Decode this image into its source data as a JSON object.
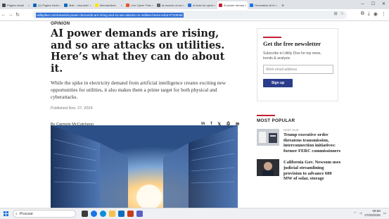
{
  "browser": {
    "tabs": [
      {
        "label": "Página Inicial",
        "color": "#4a4a4a",
        "active": false
      },
      {
        "label": "(2) Página Inicial",
        "color": "#0a66c2",
        "active": false
      },
      {
        "label": "Mail – elsa.abei",
        "color": "#0f6cbd",
        "active": false
      },
      {
        "label": "Mercadolivre",
        "color": "#ffe600",
        "active": false
      },
      {
        "label": "Live Cyber Threat",
        "color": "#e4572e",
        "active": false
      },
      {
        "label": "ai-recover-of-ener",
        "color": "#5f6368",
        "active": false
      },
      {
        "label": "AI bots for cyberc",
        "color": "#2a6fdb",
        "active": false
      },
      {
        "label": "AI power demands",
        "color": "#c22032",
        "active": true
      },
      {
        "label": "Generative AI th",
        "color": "#1a73e8",
        "active": false
      }
    ],
    "new_tab": "+",
    "url": "utilitydive.com/news/ai-power-demands-are-rising-and-so-are-attacks-on-utilities-heres-what-t/733946/"
  },
  "article": {
    "kicker": "OPINION",
    "headline": "AI power demands are rising, and so are attacks on utilities. Here’s what they can do about it.",
    "dek": "While the spike in electricity demand from artificial intelligence creates exciting new opportunities for utilities, it also makes them a prime target for both physical and cyberattacks.",
    "published": "Published Nov. 27, 2024",
    "byline": "By Carmelo McCutcheon",
    "share": {
      "linkedin": "in",
      "facebook": "f",
      "x": "𝕏",
      "print": "⎙",
      "email": "✉"
    }
  },
  "newsletter": {
    "title": "Get the free newsletter",
    "description": "Subscribe to Utility Dive for top news, trends & analysis",
    "placeholder": "Work email address",
    "button": "Sign up"
  },
  "popular": {
    "title": "MOST POPULAR",
    "items": [
      {
        "category": "DEEP DIVE",
        "headline": "Trump executive order threatens transmission, interconnection initiatives: former FERC commissioners"
      },
      {
        "category": "",
        "headline": "California Gov. Newsom uses judicial streamlining provision to advance 600 MW of solar, storage"
      }
    ]
  },
  "taskbar": {
    "search": "Procurar",
    "time": "08:58",
    "date": "27/03/2025"
  },
  "colors": {
    "accent": "#c22032",
    "button": "#2b3c8c",
    "selection": "#2f6fd6"
  }
}
